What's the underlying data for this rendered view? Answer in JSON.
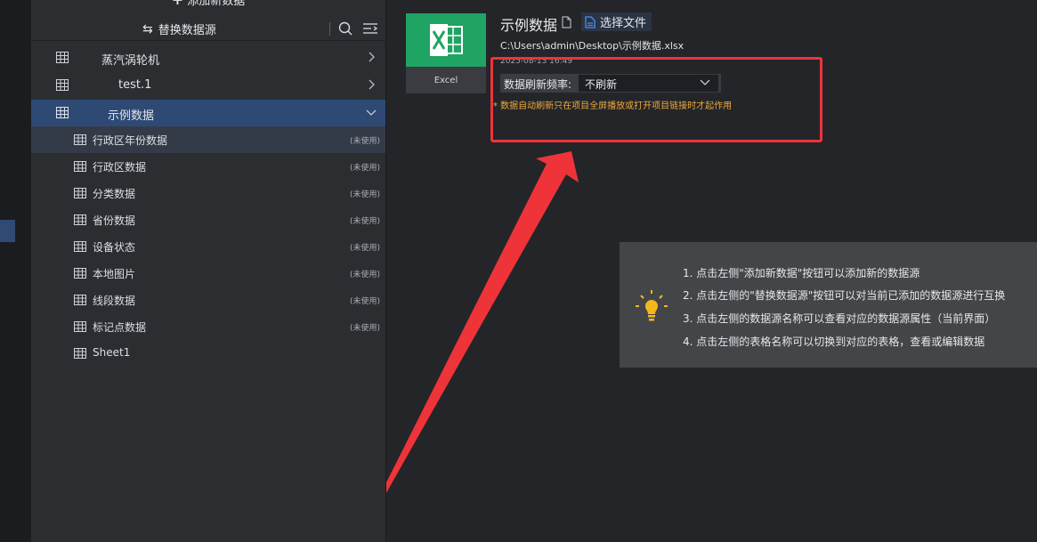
{
  "sidebar": {
    "add_new": "添加新数据",
    "replace_source": "替换数据源",
    "sources": [
      {
        "name": "蒸汽涡轮机"
      },
      {
        "name": "test.1"
      },
      {
        "name": "示例数据"
      }
    ],
    "tables": [
      {
        "name": "行政区年份数据",
        "status": "(未使用)"
      },
      {
        "name": "行政区数据",
        "status": "(未使用)"
      },
      {
        "name": "分类数据",
        "status": "(未使用)"
      },
      {
        "name": "省份数据",
        "status": "(未使用)"
      },
      {
        "name": "设备状态",
        "status": "(未使用)"
      },
      {
        "name": "本地图片",
        "status": "(未使用)"
      },
      {
        "name": "线段数据",
        "status": "(未使用)"
      },
      {
        "name": "标记点数据",
        "status": "(未使用)"
      },
      {
        "name": "Sheet1",
        "status": ""
      }
    ]
  },
  "detail": {
    "file_type": "Excel",
    "title": "示例数据",
    "choose_file": "选择文件",
    "path": "C:\\Users\\admin\\Desktop\\示例数据.xlsx",
    "date": "2025-08-13 16:49",
    "refresh_label": "数据刷新频率:",
    "refresh_value": "不刷新",
    "note": "* 数据自动刷新只在项目全屏播放或打开项目链接时才起作用"
  },
  "tips": [
    "1. 点击左侧\"添加新数据\"按钮可以添加新的数据源",
    "2. 点击左侧的\"替换数据源\"按钮可以对当前已添加的数据源进行互换",
    "3. 点击左侧的数据源名称可以查看对应的数据源属性（当前界面）",
    "4. 点击左侧的表格名称可以切换到对应的表格，查看或编辑数据"
  ],
  "colors": {
    "accent": "#2e4a74",
    "excel_green": "#1fa463",
    "highlight_red": "#ee3438",
    "note_orange": "#f0a93a",
    "bulb_yellow": "#f5b81c"
  },
  "icons": [
    "table-grid-icon",
    "chevron-right-icon",
    "chevron-down-icon",
    "search-icon",
    "filter-list-icon",
    "swap-icon",
    "excel-icon",
    "copy-icon",
    "file-icon",
    "lightbulb-icon"
  ]
}
